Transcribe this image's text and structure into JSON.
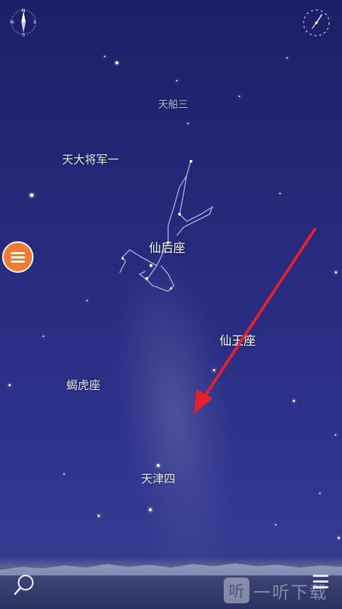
{
  "labels": {
    "tianchuan3": "天船三",
    "tiandajiangjun1": "天大将军一",
    "cassiopeia": "仙后座",
    "cepheus": "仙王座",
    "lacerta": "蝎虎座",
    "tianjin4": "天津四"
  },
  "compass": {
    "n": "N",
    "e": "E",
    "s": "S",
    "w": "W"
  },
  "watermark": {
    "logo": "听",
    "text": "一听下载"
  },
  "colors": {
    "sky_top": "#1d1f66",
    "sky_bottom": "#39418f",
    "menu_button": "#f07a2f",
    "arrow": "#e8202a"
  },
  "icons": {
    "compass": "compass-icon",
    "clock": "clock-icon",
    "menu": "menu-icon",
    "search": "search-icon",
    "bottom_menu": "list-menu-icon"
  }
}
